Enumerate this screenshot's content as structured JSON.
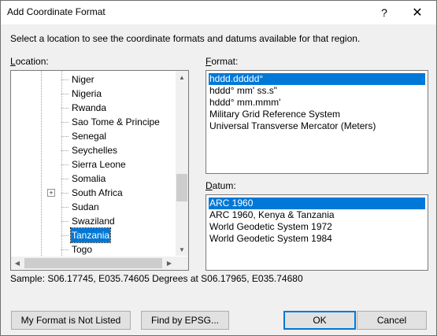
{
  "window": {
    "title": "Add Coordinate Format",
    "help_glyph": "?",
    "close_glyph": "✕"
  },
  "instruction": "Select a location to see the coordinate formats and datums available for that region.",
  "location": {
    "label_access": "L",
    "label_rest": "ocation:",
    "items": [
      {
        "label": "Niger",
        "selected": false,
        "expandable": false
      },
      {
        "label": "Nigeria",
        "selected": false,
        "expandable": false
      },
      {
        "label": "Rwanda",
        "selected": false,
        "expandable": false
      },
      {
        "label": "Sao Tome & Principe",
        "selected": false,
        "expandable": false
      },
      {
        "label": "Senegal",
        "selected": false,
        "expandable": false
      },
      {
        "label": "Seychelles",
        "selected": false,
        "expandable": false
      },
      {
        "label": "Sierra Leone",
        "selected": false,
        "expandable": false
      },
      {
        "label": "Somalia",
        "selected": false,
        "expandable": false
      },
      {
        "label": "South Africa",
        "selected": false,
        "expandable": true
      },
      {
        "label": "Sudan",
        "selected": false,
        "expandable": false
      },
      {
        "label": "Swaziland",
        "selected": false,
        "expandable": false
      },
      {
        "label": "Tanzania",
        "selected": true,
        "expandable": false
      },
      {
        "label": "Togo",
        "selected": false,
        "expandable": false
      }
    ]
  },
  "format": {
    "label_access": "F",
    "label_rest": "ormat:",
    "items": [
      {
        "label": "hddd.ddddd°",
        "selected": true
      },
      {
        "label": "hddd° mm' ss.s\"",
        "selected": false
      },
      {
        "label": "hddd° mm.mmm'",
        "selected": false
      },
      {
        "label": "Military Grid Reference System",
        "selected": false
      },
      {
        "label": "Universal Transverse Mercator (Meters)",
        "selected": false
      }
    ]
  },
  "datum": {
    "label_access": "D",
    "label_rest": "atum:",
    "items": [
      {
        "label": "ARC 1960",
        "selected": true
      },
      {
        "label": "ARC 1960, Kenya & Tanzania",
        "selected": false
      },
      {
        "label": "World Geodetic System 1972",
        "selected": false
      },
      {
        "label": "World Geodetic System 1984",
        "selected": false
      }
    ]
  },
  "sample": "Sample: S06.17745, E035.74605 Degrees at S06.17965, E035.74680",
  "buttons": {
    "my_format": "My Format is Not Listed",
    "find_epsg": "Find by EPSG...",
    "ok": "OK",
    "cancel": "Cancel"
  }
}
